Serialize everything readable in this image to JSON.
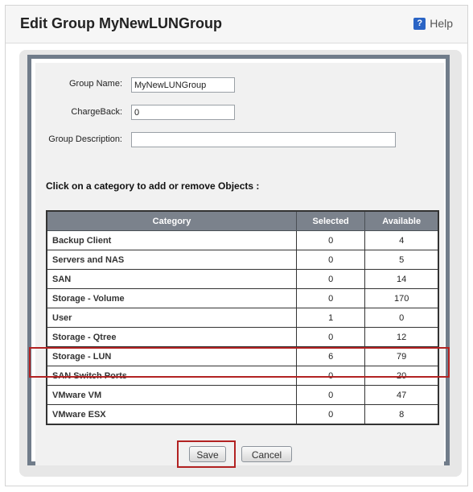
{
  "dialog": {
    "title": "Edit Group MyNewLUNGroup",
    "help_label": "Help",
    "help_icon": "question-mark-icon"
  },
  "form": {
    "group_name_label": "Group Name:",
    "group_name_value": "MyNewLUNGroup",
    "chargeback_label": "ChargeBack:",
    "chargeback_value": "0",
    "description_label": "Group Description:",
    "description_value": ""
  },
  "instruction": "Click on a category to add or remove Objects :",
  "table": {
    "headers": [
      "Category",
      "Selected",
      "Available"
    ],
    "rows": [
      {
        "category": "Backup Client",
        "selected": "0",
        "available": "4"
      },
      {
        "category": "Servers and NAS",
        "selected": "0",
        "available": "5"
      },
      {
        "category": "SAN",
        "selected": "0",
        "available": "14"
      },
      {
        "category": "Storage - Volume",
        "selected": "0",
        "available": "170"
      },
      {
        "category": "User",
        "selected": "1",
        "available": "0"
      },
      {
        "category": "Storage - Qtree",
        "selected": "0",
        "available": "12"
      },
      {
        "category": "Storage - LUN",
        "selected": "6",
        "available": "79"
      },
      {
        "category": "SAN Switch Ports",
        "selected": "0",
        "available": "20"
      },
      {
        "category": "VMware VM",
        "selected": "0",
        "available": "47"
      },
      {
        "category": "VMware ESX",
        "selected": "0",
        "available": "8"
      }
    ]
  },
  "buttons": {
    "save_label": "Save",
    "cancel_label": "Cancel"
  },
  "colors": {
    "highlight": "#b22222",
    "header_bg": "#7b828c",
    "panel_border": "#707c8a"
  }
}
